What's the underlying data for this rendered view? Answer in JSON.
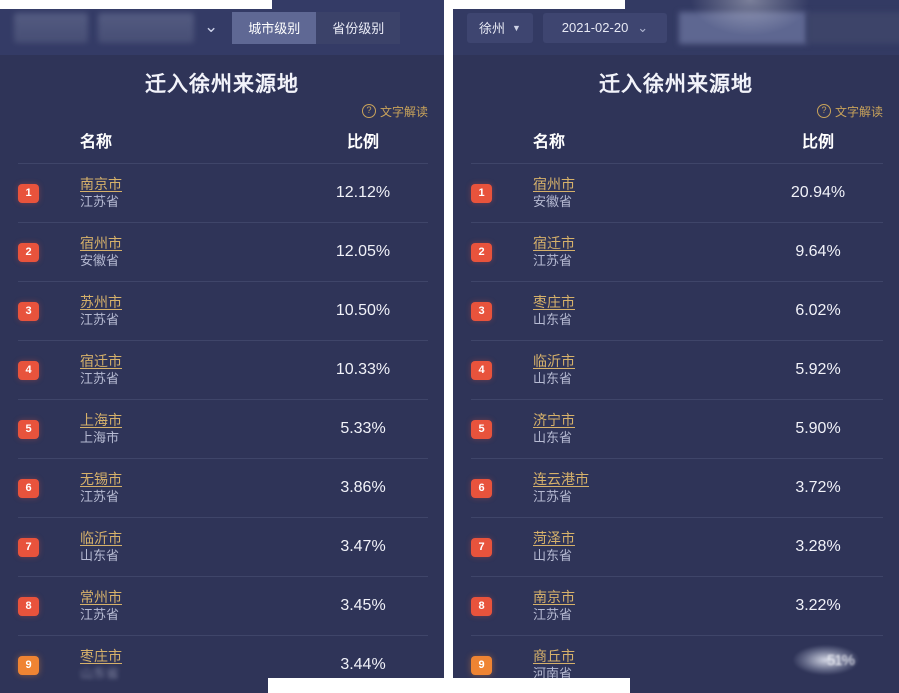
{
  "left_panel": {
    "toolbar": {
      "obscured_control_1": "",
      "obscured_control_2": "",
      "chevron_icon": "⌄",
      "tabs": [
        {
          "label": "城市级别",
          "active": true
        },
        {
          "label": "省份级别",
          "active": false
        }
      ]
    },
    "title": "迁入徐州来源地",
    "help_link": {
      "icon": "?",
      "label": "文字解读"
    },
    "table": {
      "headers": {
        "rank": "",
        "name": "名称",
        "value": "比例"
      },
      "rows": [
        {
          "rank": "1",
          "city": "南京市",
          "province": "江苏省",
          "value": "12.12%"
        },
        {
          "rank": "2",
          "city": "宿州市",
          "province": "安徽省",
          "value": "12.05%"
        },
        {
          "rank": "3",
          "city": "苏州市",
          "province": "江苏省",
          "value": "10.50%"
        },
        {
          "rank": "4",
          "city": "宿迁市",
          "province": "江苏省",
          "value": "10.33%"
        },
        {
          "rank": "5",
          "city": "上海市",
          "province": "上海市",
          "value": "5.33%"
        },
        {
          "rank": "6",
          "city": "无锡市",
          "province": "江苏省",
          "value": "3.86%"
        },
        {
          "rank": "7",
          "city": "临沂市",
          "province": "山东省",
          "value": "3.47%"
        },
        {
          "rank": "8",
          "city": "常州市",
          "province": "江苏省",
          "value": "3.45%"
        },
        {
          "rank": "9",
          "city": "枣庄市",
          "province": "山东省",
          "value": "3.44%"
        }
      ]
    }
  },
  "right_panel": {
    "toolbar": {
      "city_select": {
        "label": "徐州",
        "caret": "▼"
      },
      "date_select": {
        "label": "2021-02-20",
        "chevron": "⌄"
      },
      "tabs": [
        {
          "label": "",
          "active": true
        },
        {
          "label": "",
          "active": false
        }
      ]
    },
    "title": "迁入徐州来源地",
    "help_link": {
      "icon": "?",
      "label": "文字解读"
    },
    "table": {
      "headers": {
        "rank": "",
        "name": "名称",
        "value": "比例"
      },
      "rows": [
        {
          "rank": "1",
          "city": "宿州市",
          "province": "安徽省",
          "value": "20.94%"
        },
        {
          "rank": "2",
          "city": "宿迁市",
          "province": "江苏省",
          "value": "9.64%"
        },
        {
          "rank": "3",
          "city": "枣庄市",
          "province": "山东省",
          "value": "6.02%"
        },
        {
          "rank": "4",
          "city": "临沂市",
          "province": "山东省",
          "value": "5.92%"
        },
        {
          "rank": "5",
          "city": "济宁市",
          "province": "山东省",
          "value": "5.90%"
        },
        {
          "rank": "6",
          "city": "连云港市",
          "province": "江苏省",
          "value": "3.72%"
        },
        {
          "rank": "7",
          "city": "菏泽市",
          "province": "山东省",
          "value": "3.28%"
        },
        {
          "rank": "8",
          "city": "南京市",
          "province": "江苏省",
          "value": "3.22%"
        },
        {
          "rank": "9",
          "city": "商丘市",
          "province": "河南省",
          "value": "51%"
        }
      ]
    }
  },
  "colors": {
    "panel_bg": "#2f3458",
    "toolbar_bg": "#343b66",
    "tab_active_bg": "#5f6894",
    "rank_badge": "#e8533c",
    "rank_badge_last": "#ef8433",
    "city_link": "#d6b16a",
    "help_link": "#c9a35a",
    "divider": "#3f4569"
  }
}
